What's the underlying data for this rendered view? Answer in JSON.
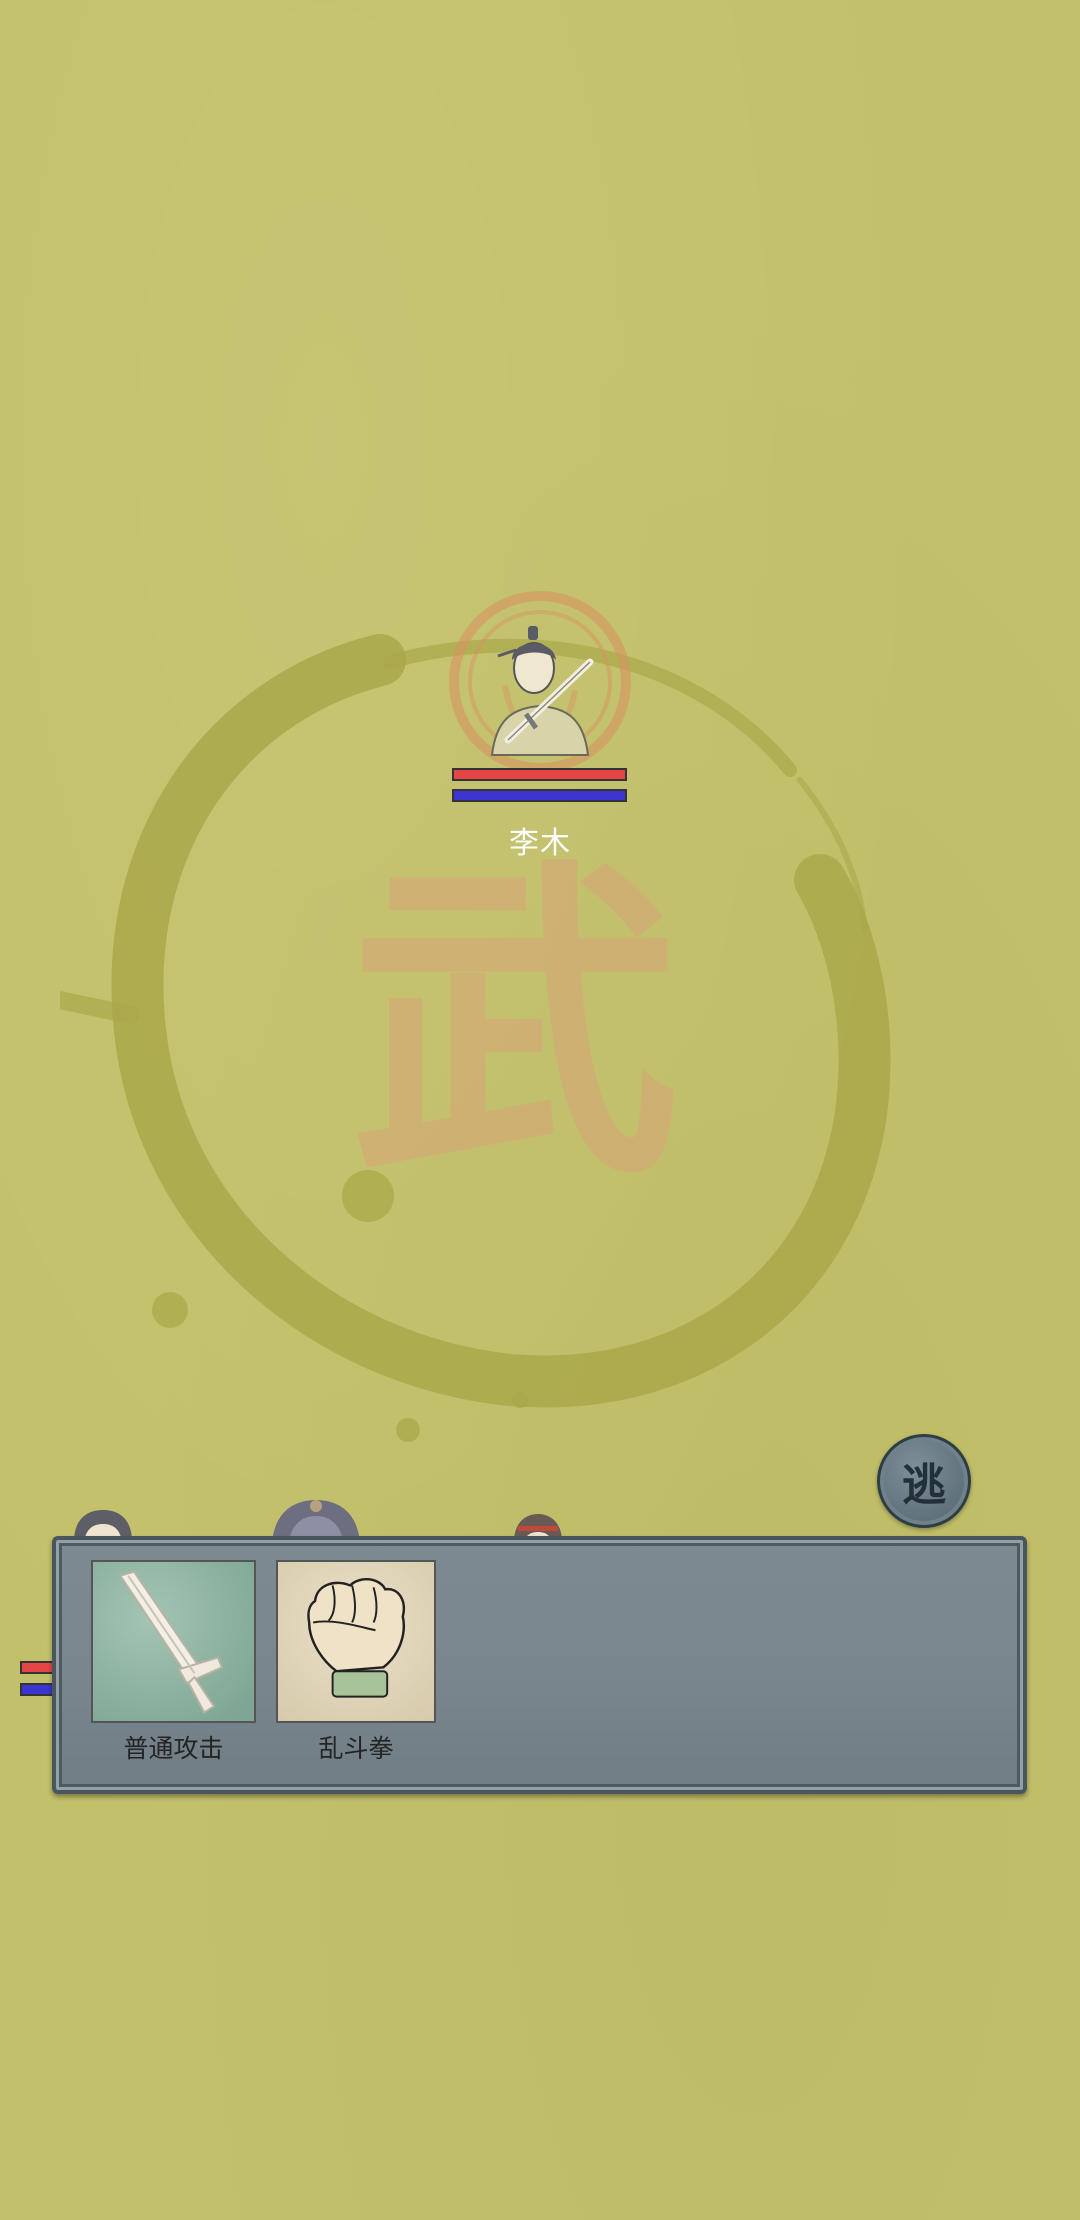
{
  "enemy": {
    "name": "李木",
    "hp": 1.0,
    "mp": 1.0,
    "portrait_icon": "swordsman-portrait-icon"
  },
  "arena": {
    "emblem_char": "武",
    "ink_ring_icon": "ink-circle-icon"
  },
  "flee_button": {
    "label": "逃"
  },
  "skills": [
    {
      "label": "普通攻击",
      "icon": "sword-icon"
    },
    {
      "label": "乱斗拳",
      "icon": "fist-icon"
    }
  ],
  "colors": {
    "background": "#c2c06a",
    "hp": "#e54545",
    "mp": "#3c35cf",
    "panel": "#7b888f",
    "emblem": "#d6a777"
  }
}
